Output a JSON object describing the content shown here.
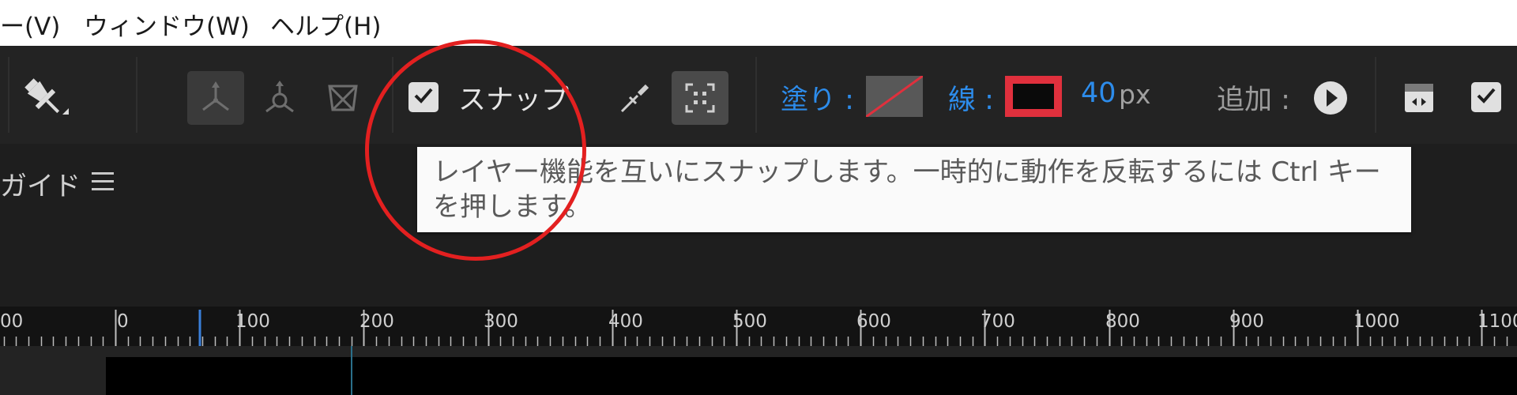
{
  "menubar": {
    "items": [
      "ー(V)",
      "ウィンドウ(W)",
      "ヘルプ(H)"
    ]
  },
  "toolbar": {
    "icons": [
      "pin-icon",
      "selection-3d-icon",
      "puppet-icon",
      "mesh-icon",
      "magnet-pen-icon",
      "snap-target-icon",
      "add-play-icon",
      "panel-toggle-icon"
    ],
    "snap_label": "スナップ",
    "snap_checked": true,
    "fill_label": "塗り :",
    "stroke_label": "線 :",
    "stroke_width_value": "40",
    "stroke_width_unit": "px",
    "add_label": "追加 :",
    "extra_checked": true,
    "colors": {
      "accent_blue": "#2d8ceb",
      "stroke_color": "#e0303d",
      "fill_color": "#585858"
    }
  },
  "panel": {
    "guide_label": "ガイド"
  },
  "tooltip": {
    "text": "レイヤー機能を互いにスナップします。一時的に動作を反転するには Ctrl キーを押します。"
  },
  "ruler": {
    "labels": [
      "00",
      "0",
      "100",
      "200",
      "300",
      "400",
      "500",
      "600",
      "700",
      "800",
      "900",
      "1000",
      "1100"
    ]
  }
}
